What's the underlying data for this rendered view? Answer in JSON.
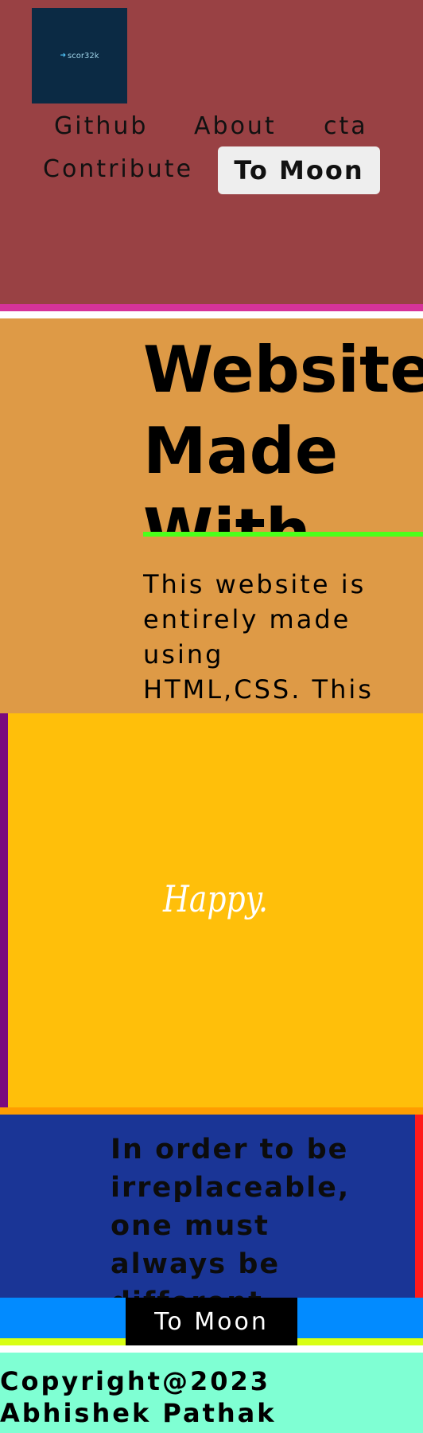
{
  "header": {
    "logo_text": "scor32k",
    "logo_mark": "➜",
    "nav": {
      "github": "Github",
      "about": "About",
      "cta": "cta",
      "contribute": "Contribute"
    },
    "cta_button": "To Moon"
  },
  "hero": {
    "title": "Website Made With HTML CSS",
    "text": "This website is entirely made using HTML,CSS. This website is made for learning purpose."
  },
  "happy": {
    "label": "Happy."
  },
  "quote": {
    "text": "In order to be irreplaceable, one must always be different"
  },
  "bottom_bar": {
    "button": "To Moon"
  },
  "footer": {
    "copyright": "Copyright@2023 Abhishek Pathak"
  },
  "colors": {
    "header_bg": "#994144",
    "header_border": "#d6339a",
    "logo_bg": "#0b2a44",
    "hero_bg": "#de9a46",
    "hero_underline": "#4cff1a",
    "happy_bg": "#ffbf0a",
    "happy_left_border": "#7a0a7e",
    "strip": "#ff9d00",
    "quote_bg": "#1a3596",
    "quote_right_border": "#ff1a1a",
    "bottom_bar_bg": "#028bff",
    "bottom_bar_border": "#d8ff14",
    "footer_bg": "#7fffd3"
  }
}
